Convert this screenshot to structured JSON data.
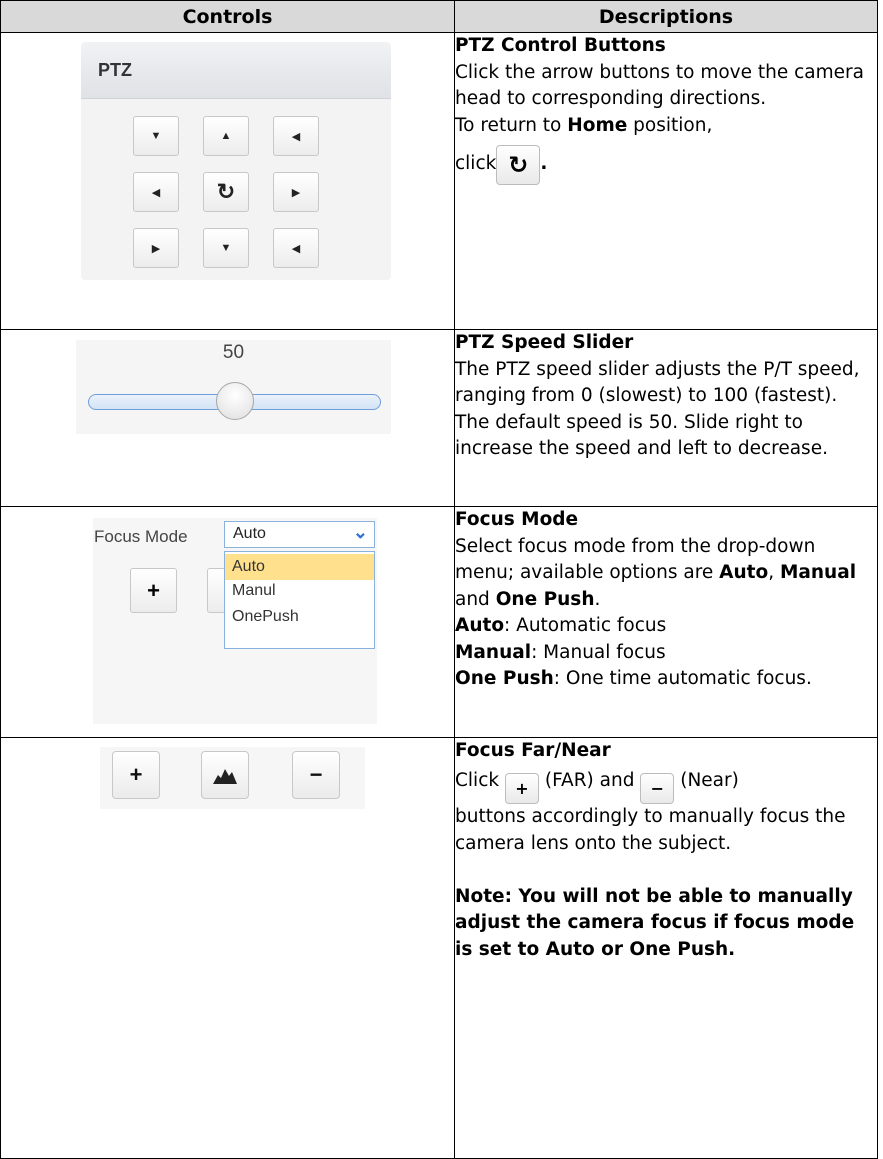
{
  "headers": {
    "controls": "Controls",
    "descriptions": "Descriptions"
  },
  "ptz_panel": {
    "title": "PTZ",
    "buttons": [
      "▼",
      "▲",
      "◀",
      "◀",
      "↻",
      "▶",
      "▶",
      "▼",
      "◀"
    ]
  },
  "slider": {
    "value_label": "50",
    "value": 50,
    "min": 0,
    "max": 100
  },
  "focus_mode_control": {
    "label": "Focus Mode",
    "selected": "Auto",
    "options": [
      "Auto",
      "Manul",
      "OnePush"
    ],
    "plus": "+"
  },
  "focus_buttons": {
    "far": "+",
    "auto": "◢◣",
    "near": "−"
  },
  "rows": {
    "ptz": {
      "title": "PTZ Control Buttons",
      "text1": "Click the arrow buttons to move the camera head to corresponding directions.",
      "text2_pre": "To return to ",
      "text2_bold": "Home",
      "text2_post": " position,",
      "click": "click",
      "period": ".",
      "home_icon": "↻"
    },
    "speed": {
      "title": "PTZ Speed Slider",
      "text": "The PTZ speed slider adjusts the P/T speed, ranging from 0 (slowest) to 100 (fastest). The default speed is 50. Slide right to increase the speed and left to decrease."
    },
    "focus_mode": {
      "title": "Focus Mode",
      "text_pre": "Select focus mode from the drop-down menu; available options are ",
      "opt1": "Auto",
      "sep1": ", ",
      "opt2": "Manual",
      "sep2": " and ",
      "opt3": "One Push",
      "end": ".",
      "auto_label": "Auto",
      "auto_desc": ": Automatic focus",
      "manual_label": "Manual",
      "manual_desc": ": Manual focus",
      "onepush_label": "One Push",
      "onepush_desc": ": One time automatic focus."
    },
    "focus_far_near": {
      "title": "Focus Far/Near",
      "click": "Click",
      "far_icon": "+",
      "far_text": "(FAR) and",
      "near_icon": "−",
      "near_text": "(Near)",
      "text": "buttons accordingly to manually focus the camera lens onto the subject.",
      "note": "Note: You will not be able to manually adjust the camera focus if focus mode is set to Auto or One Push."
    }
  }
}
